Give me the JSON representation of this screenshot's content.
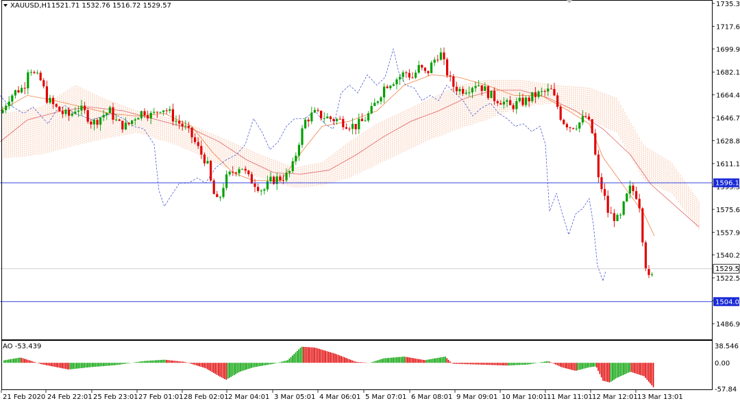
{
  "header": {
    "symbol": "XAUUSD,H1",
    "ohlc": "1521.71 1532.76 1516.72 1529.57"
  },
  "indicator": {
    "label": "AO -53.439",
    "axis_labels": [
      "38.546",
      "0.00",
      "-57.84"
    ]
  },
  "colors": {
    "bull": "#00a000",
    "bear": "#e00000",
    "ichimoku_cloud": "#f4b08a",
    "ma_orange": "#f08040",
    "ma_red": "#e06060",
    "chikou_blue": "#3344cc",
    "hline_blue": "#3344dd",
    "price_tag_blue": "#1a2ad8",
    "grid_line": "#c8c8c8",
    "frame": "#000000"
  },
  "chart_data": [
    {
      "type": "line",
      "title": "XAUUSD,H1",
      "subtitle": "1521.71 1532.76 1516.72 1529.57",
      "y_ticks": [
        "1735.35",
        "1717.65",
        "1699.95",
        "1682.15",
        "1664.40",
        "1646.70",
        "1628.85",
        "1611.15",
        "1593.35",
        "1575.60",
        "1557.90",
        "1540.20",
        "1522.50",
        "1504.65",
        "1486.95"
      ],
      "x_ticks": [
        "21 Feb 2020",
        "24 Feb 22:01",
        "25 Feb 23:01",
        "27 Feb 01:01",
        "28 Feb 02:01",
        "2 Mar 04:01",
        "3 Mar 05:01",
        "4 Mar 06:01",
        "5 Mar 07:01",
        "6 Mar 08:01",
        "9 Mar 09:01",
        "10 Mar 10:01",
        "11 Mar 11:01",
        "12 Mar 12:01",
        "13 Mar 13:01"
      ],
      "ylim": [
        1480,
        1738
      ],
      "horizontal_lines": [
        {
          "value": 1596.19,
          "label": "1596.19"
        },
        {
          "value": 1504.05,
          "label": "1504.05"
        }
      ],
      "current_price": {
        "value": 1529.57,
        "label": "1529.57"
      },
      "close_path": [
        [
          0,
          1648
        ],
        [
          12,
          1662
        ],
        [
          25,
          1668
        ],
        [
          35,
          1670
        ],
        [
          42,
          1688
        ],
        [
          50,
          1680
        ],
        [
          60,
          1675
        ],
        [
          68,
          1662
        ],
        [
          80,
          1655
        ],
        [
          92,
          1650
        ],
        [
          102,
          1648
        ],
        [
          112,
          1655
        ],
        [
          125,
          1650
        ],
        [
          135,
          1642
        ],
        [
          148,
          1648
        ],
        [
          160,
          1652
        ],
        [
          172,
          1642
        ],
        [
          185,
          1640
        ],
        [
          198,
          1648
        ],
        [
          210,
          1652
        ],
        [
          222,
          1648
        ],
        [
          235,
          1655
        ],
        [
          245,
          1652
        ],
        [
          255,
          1645
        ],
        [
          268,
          1640
        ],
        [
          280,
          1632
        ],
        [
          292,
          1620
        ],
        [
          302,
          1612
        ],
        [
          310,
          1590
        ],
        [
          318,
          1580
        ],
        [
          328,
          1598
        ],
        [
          340,
          1605
        ],
        [
          352,
          1610
        ],
        [
          362,
          1600
        ],
        [
          372,
          1596
        ],
        [
          384,
          1590
        ],
        [
          396,
          1598
        ],
        [
          408,
          1600
        ],
        [
          420,
          1602
        ],
        [
          428,
          1610
        ],
        [
          436,
          1628
        ],
        [
          446,
          1645
        ],
        [
          458,
          1650
        ],
        [
          470,
          1648
        ],
        [
          482,
          1646
        ],
        [
          494,
          1645
        ],
        [
          506,
          1642
        ],
        [
          518,
          1640
        ],
        [
          530,
          1644
        ],
        [
          542,
          1652
        ],
        [
          552,
          1662
        ],
        [
          562,
          1672
        ],
        [
          572,
          1675
        ],
        [
          582,
          1678
        ],
        [
          592,
          1682
        ],
        [
          602,
          1678
        ],
        [
          612,
          1686
        ],
        [
          622,
          1680
        ],
        [
          632,
          1690
        ],
        [
          642,
          1698
        ],
        [
          650,
          1685
        ],
        [
          660,
          1672
        ],
        [
          672,
          1668
        ],
        [
          684,
          1670
        ],
        [
          696,
          1674
        ],
        [
          708,
          1668
        ],
        [
          720,
          1662
        ],
        [
          732,
          1660
        ],
        [
          744,
          1655
        ],
        [
          756,
          1658
        ],
        [
          768,
          1660
        ],
        [
          780,
          1664
        ],
        [
          792,
          1666
        ],
        [
          804,
          1668
        ],
        [
          812,
          1658
        ],
        [
          820,
          1645
        ],
        [
          832,
          1640
        ],
        [
          844,
          1642
        ],
        [
          856,
          1648
        ],
        [
          866,
          1632
        ],
        [
          872,
          1600
        ],
        [
          880,
          1590
        ],
        [
          888,
          1572
        ],
        [
          896,
          1570
        ],
        [
          904,
          1566
        ],
        [
          912,
          1582
        ],
        [
          920,
          1592
        ],
        [
          928,
          1588
        ],
        [
          934,
          1578
        ],
        [
          940,
          1540
        ],
        [
          946,
          1522
        ],
        [
          950,
          1520
        ],
        [
          955,
          1529.57
        ]
      ],
      "chikou_path": [
        [
          0,
          1664
        ],
        [
          10,
          1658
        ],
        [
          22,
          1654
        ],
        [
          35,
          1650
        ],
        [
          48,
          1655
        ],
        [
          60,
          1648
        ],
        [
          70,
          1642
        ],
        [
          82,
          1652
        ],
        [
          95,
          1656
        ],
        [
          108,
          1650
        ],
        [
          120,
          1648
        ],
        [
          135,
          1645
        ],
        [
          150,
          1648
        ],
        [
          165,
          1650
        ],
        [
          180,
          1646
        ],
        [
          195,
          1640
        ],
        [
          210,
          1638
        ],
        [
          225,
          1626
        ],
        [
          232,
          1590
        ],
        [
          240,
          1578
        ],
        [
          252,
          1588
        ],
        [
          262,
          1596
        ],
        [
          275,
          1596
        ],
        [
          288,
          1600
        ],
        [
          300,
          1596
        ],
        [
          315,
          1608
        ],
        [
          330,
          1614
        ],
        [
          345,
          1618
        ],
        [
          358,
          1626
        ],
        [
          370,
          1646
        ],
        [
          382,
          1636
        ],
        [
          394,
          1622
        ],
        [
          406,
          1628
        ],
        [
          418,
          1640
        ],
        [
          430,
          1646
        ],
        [
          445,
          1646
        ],
        [
          460,
          1652
        ],
        [
          474,
          1642
        ],
        [
          486,
          1638
        ],
        [
          498,
          1666
        ],
        [
          510,
          1672
        ],
        [
          522,
          1666
        ],
        [
          536,
          1680
        ],
        [
          550,
          1672
        ],
        [
          562,
          1678
        ],
        [
          574,
          1700
        ],
        [
          582,
          1682
        ],
        [
          592,
          1672
        ],
        [
          604,
          1670
        ],
        [
          616,
          1660
        ],
        [
          628,
          1664
        ],
        [
          640,
          1660
        ],
        [
          652,
          1672
        ],
        [
          664,
          1666
        ],
        [
          676,
          1660
        ],
        [
          690,
          1648
        ],
        [
          702,
          1654
        ],
        [
          716,
          1658
        ],
        [
          728,
          1650
        ],
        [
          740,
          1646
        ],
        [
          752,
          1640
        ],
        [
          764,
          1642
        ],
        [
          776,
          1636
        ],
        [
          788,
          1640
        ],
        [
          796,
          1626
        ],
        [
          802,
          1574
        ],
        [
          812,
          1588
        ],
        [
          822,
          1570
        ],
        [
          830,
          1556
        ],
        [
          840,
          1572
        ],
        [
          850,
          1576
        ],
        [
          860,
          1584
        ],
        [
          866,
          1564
        ],
        [
          872,
          1532
        ],
        [
          880,
          1520
        ],
        [
          884,
          1528
        ]
      ],
      "ma_path": [
        [
          0,
          1628
        ],
        [
          40,
          1645
        ],
        [
          90,
          1652
        ],
        [
          130,
          1655
        ],
        [
          180,
          1652
        ],
        [
          230,
          1645
        ],
        [
          280,
          1638
        ],
        [
          320,
          1628
        ],
        [
          360,
          1614
        ],
        [
          400,
          1604
        ],
        [
          440,
          1603
        ],
        [
          480,
          1606
        ],
        [
          520,
          1618
        ],
        [
          560,
          1632
        ],
        [
          600,
          1644
        ],
        [
          640,
          1652
        ],
        [
          680,
          1662
        ],
        [
          720,
          1668
        ],
        [
          760,
          1668
        ],
        [
          800,
          1662
        ],
        [
          840,
          1652
        ],
        [
          880,
          1638
        ],
        [
          920,
          1618
        ],
        [
          950,
          1595
        ],
        [
          1020,
          1562
        ]
      ],
      "ma_fast_path": [
        [
          0,
          1652
        ],
        [
          40,
          1664
        ],
        [
          80,
          1660
        ],
        [
          120,
          1655
        ],
        [
          160,
          1650
        ],
        [
          200,
          1648
        ],
        [
          240,
          1650
        ],
        [
          280,
          1640
        ],
        [
          310,
          1620
        ],
        [
          340,
          1604
        ],
        [
          370,
          1598
        ],
        [
          410,
          1598
        ],
        [
          440,
          1620
        ],
        [
          470,
          1640
        ],
        [
          510,
          1644
        ],
        [
          550,
          1652
        ],
        [
          590,
          1672
        ],
        [
          630,
          1680
        ],
        [
          670,
          1678
        ],
        [
          710,
          1672
        ],
        [
          750,
          1664
        ],
        [
          790,
          1664
        ],
        [
          830,
          1652
        ],
        [
          860,
          1642
        ],
        [
          880,
          1616
        ],
        [
          910,
          1594
        ],
        [
          940,
          1572
        ],
        [
          955,
          1555
        ]
      ],
      "cloud_ranges": [
        [
          5,
          1615,
          1650
        ],
        [
          60,
          1618,
          1655
        ],
        [
          110,
          1625,
          1672
        ],
        [
          150,
          1630,
          1662
        ],
        [
          200,
          1635,
          1652
        ],
        [
          260,
          1625,
          1645
        ],
        [
          320,
          1610,
          1632
        ],
        [
          380,
          1600,
          1618
        ],
        [
          430,
          1592,
          1608
        ],
        [
          470,
          1594,
          1612
        ],
        [
          510,
          1600,
          1628
        ],
        [
          550,
          1610,
          1642
        ],
        [
          590,
          1620,
          1652
        ],
        [
          630,
          1630,
          1662
        ],
        [
          670,
          1638,
          1672
        ],
        [
          710,
          1645,
          1676
        ],
        [
          760,
          1655,
          1676
        ],
        [
          810,
          1658,
          1672
        ],
        [
          860,
          1645,
          1670
        ],
        [
          900,
          1635,
          1662
        ],
        [
          940,
          1598,
          1625
        ],
        [
          980,
          1588,
          1612
        ],
        [
          1020,
          1560,
          1582
        ]
      ],
      "volatility": 8
    },
    {
      "type": "bar",
      "title": "AO -53.439",
      "ylim": [
        -57.84,
        38.546
      ],
      "segments": [
        [
          0,
          4
        ],
        [
          30,
          12
        ],
        [
          60,
          -3
        ],
        [
          80,
          -9
        ],
        [
          100,
          -15
        ],
        [
          130,
          -10
        ],
        [
          170,
          -5
        ],
        [
          210,
          4
        ],
        [
          240,
          7
        ],
        [
          270,
          2
        ],
        [
          300,
          -12
        ],
        [
          320,
          -30
        ],
        [
          330,
          -38
        ],
        [
          350,
          -20
        ],
        [
          370,
          -10
        ],
        [
          400,
          -2
        ],
        [
          420,
          6
        ],
        [
          440,
          36
        ],
        [
          460,
          34
        ],
        [
          490,
          20
        ],
        [
          520,
          2
        ],
        [
          540,
          0
        ],
        [
          560,
          10
        ],
        [
          590,
          14
        ],
        [
          620,
          6
        ],
        [
          650,
          14
        ],
        [
          660,
          -2
        ],
        [
          700,
          -4
        ],
        [
          740,
          -6
        ],
        [
          770,
          -4
        ],
        [
          800,
          4
        ],
        [
          820,
          -10
        ],
        [
          840,
          -18
        ],
        [
          860,
          -10
        ],
        [
          870,
          -8
        ],
        [
          880,
          -40
        ],
        [
          890,
          -44
        ],
        [
          900,
          -34
        ],
        [
          920,
          -20
        ],
        [
          940,
          -30
        ],
        [
          955,
          -57
        ]
      ]
    }
  ]
}
